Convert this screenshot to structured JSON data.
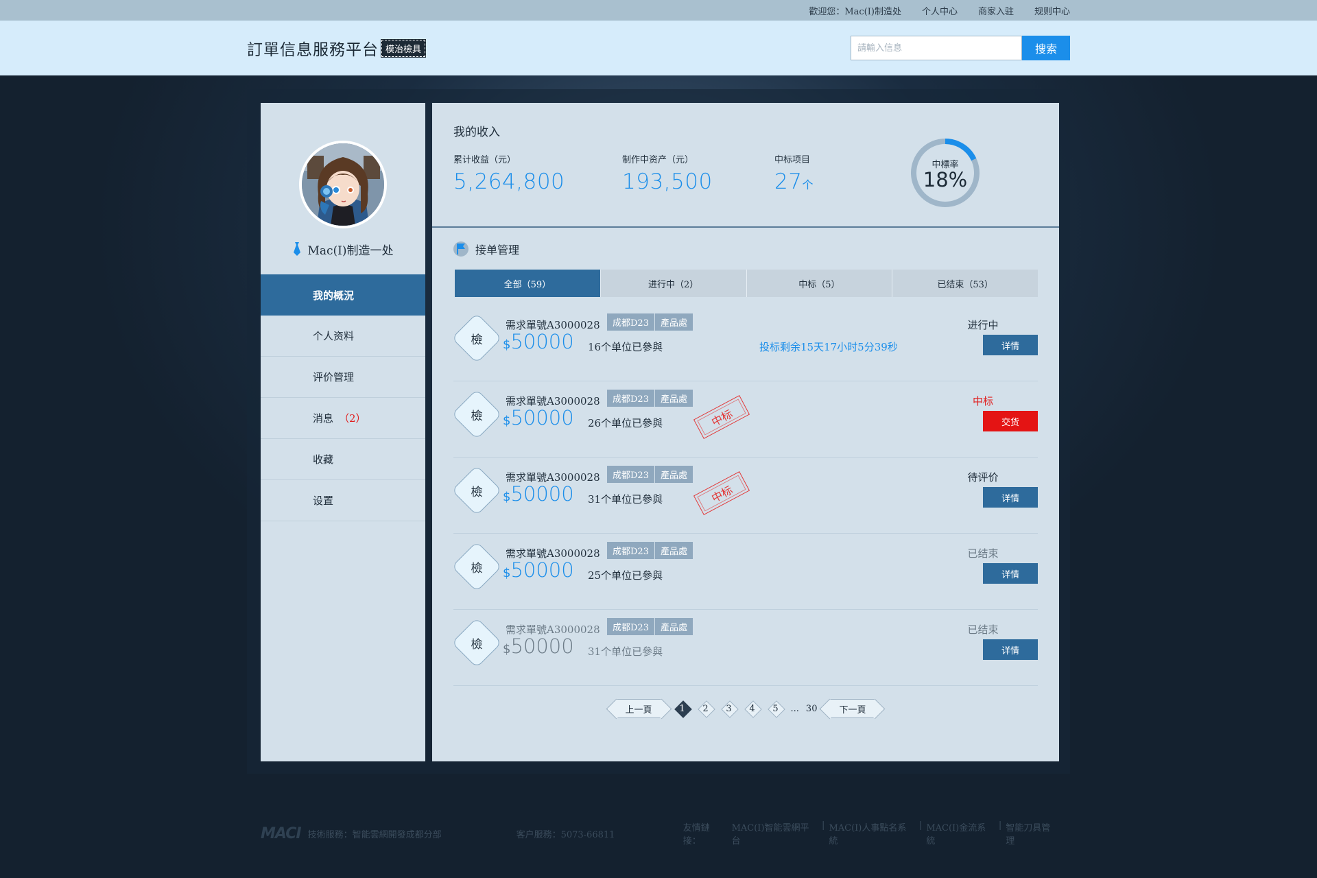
{
  "topbar": {
    "welcome": "歡迎您：Mac(I)制造处",
    "links": [
      "个人中心",
      "商家入驻",
      "规则中心"
    ]
  },
  "header": {
    "title": "訂單信息服務平台",
    "badge": "模治檢具",
    "search_placeholder": "請輸入信息",
    "search_button": "搜索"
  },
  "user": {
    "name": "Mac(I)制造一处",
    "icon": "tie-icon"
  },
  "nav": [
    {
      "label": "我的概況",
      "count": "",
      "active": true
    },
    {
      "label": "个人资料",
      "count": ""
    },
    {
      "label": "评价管理",
      "count": ""
    },
    {
      "label": "消息",
      "count": "（2）"
    },
    {
      "label": "收藏",
      "count": ""
    },
    {
      "label": "设置",
      "count": ""
    }
  ],
  "income": {
    "title": "我的收入",
    "stats": [
      {
        "label": "累计收益（元）",
        "value": "5,264,800",
        "unit": ""
      },
      {
        "label": "制作中资产（元）",
        "value": "193,500",
        "unit": ""
      },
      {
        "label": "中标项目",
        "value": "27",
        "unit": "个"
      }
    ],
    "rate_label": "中標率",
    "rate_value": "18%",
    "rate_fraction": 0.18
  },
  "orders": {
    "title": "接单管理",
    "tabs": [
      "全部（59）",
      "进行中（2）",
      "中标（5）",
      "已结束（53）"
    ],
    "items": [
      {
        "icon_text": "檢",
        "no": "需求單號A3000028",
        "tags": [
          "成都D23",
          "產品處"
        ],
        "currency": "$",
        "amount": "50000",
        "participants": "16个单位已參與",
        "timer": "投标剩余15天17小时5分39秒",
        "stamp": "",
        "status": "进行中",
        "button": "详情",
        "muted": false,
        "status_style": "",
        "button_style": ""
      },
      {
        "icon_text": "檢",
        "no": "需求單號A3000028",
        "tags": [
          "成都D23",
          "產品處"
        ],
        "currency": "$",
        "amount": "50000",
        "participants": "26个单位已參與",
        "timer": "",
        "stamp": "中标",
        "status": "中标",
        "button": "交货",
        "muted": false,
        "status_style": "red",
        "button_style": "red"
      },
      {
        "icon_text": "檢",
        "no": "需求單號A3000028",
        "tags": [
          "成都D23",
          "產品處"
        ],
        "currency": "$",
        "amount": "50000",
        "participants": "31个单位已參與",
        "timer": "",
        "stamp": "中标",
        "status": "待评价",
        "button": "详情",
        "muted": false,
        "status_style": "",
        "button_style": ""
      },
      {
        "icon_text": "檢",
        "no": "需求單號A3000028",
        "tags": [
          "成都D23",
          "產品處"
        ],
        "currency": "$",
        "amount": "50000",
        "participants": "25个单位已參與",
        "timer": "",
        "stamp": "",
        "status": "已结束",
        "button": "详情",
        "muted": false,
        "status_style": "grey",
        "button_style": ""
      },
      {
        "icon_text": "檢",
        "no": "需求單號A3000028",
        "tags": [
          "成都D23",
          "產品處"
        ],
        "currency": "$",
        "amount": "50000",
        "participants": "31个单位已參與",
        "timer": "",
        "stamp": "",
        "status": "已结束",
        "button": "详情",
        "muted": true,
        "status_style": "grey",
        "button_style": ""
      }
    ]
  },
  "pagination": {
    "prev": "上一頁",
    "next": "下一頁",
    "pages": [
      "1",
      "2",
      "3",
      "4",
      "5"
    ],
    "ellipsis": "...",
    "last": "30",
    "current": "1"
  },
  "footer": {
    "logo": "MACI",
    "tech": "技術服務：智能雲網開發成都分部",
    "service": "客户服務：5073-66811",
    "links_label": "友情鏈接：",
    "links": [
      "MAC(I)智能雲網平台",
      "MAC(I)人事點名系統",
      "MAC(I)金流系統",
      "智能刀具管理"
    ]
  }
}
